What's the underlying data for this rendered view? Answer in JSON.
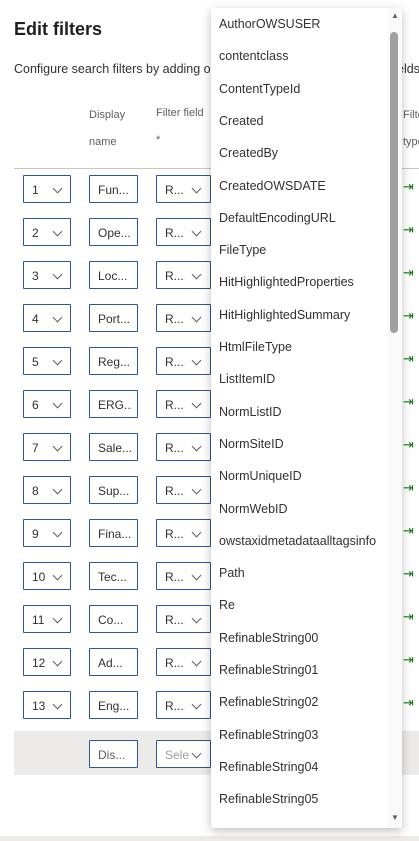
{
  "panel": {
    "title": "Edit filters",
    "description": "Configure search filters by adding o",
    "description_tail": "elds"
  },
  "headers": {
    "display_name_1": "Display",
    "display_name_2": "name",
    "filter_field_1": "Filter field",
    "filter_field_2": "*",
    "filter_type_1": "Filte",
    "filter_type_2": "type"
  },
  "rows": [
    {
      "index": "1",
      "display_name": "Fun...",
      "filter_field": "R..."
    },
    {
      "index": "2",
      "display_name": "Ope...",
      "filter_field": "R..."
    },
    {
      "index": "3",
      "display_name": "Loc...",
      "filter_field": "R..."
    },
    {
      "index": "4",
      "display_name": "Port...",
      "filter_field": "R..."
    },
    {
      "index": "5",
      "display_name": "Reg...",
      "filter_field": "R..."
    },
    {
      "index": "6",
      "display_name": "ERG...",
      "filter_field": "R..."
    },
    {
      "index": "7",
      "display_name": "Sale...",
      "filter_field": "R..."
    },
    {
      "index": "8",
      "display_name": "Sup...",
      "filter_field": "R..."
    },
    {
      "index": "9",
      "display_name": "Fina...",
      "filter_field": "R..."
    },
    {
      "index": "10",
      "display_name": "Tec...",
      "filter_field": "R..."
    },
    {
      "index": "11",
      "display_name": "Co...",
      "filter_field": "R..."
    },
    {
      "index": "12",
      "display_name": "Ad...",
      "filter_field": "R..."
    },
    {
      "index": "13",
      "display_name": "Eng...",
      "filter_field": "R..."
    }
  ],
  "new_row": {
    "display_name": "Dis...",
    "filter_field": "Sele"
  },
  "dropdown_options": [
    "AuthorOWSUSER",
    "contentclass",
    "ContentTypeId",
    "Created",
    "CreatedBy",
    "CreatedOWSDATE",
    "DefaultEncodingURL",
    "FileType",
    "HitHighlightedProperties",
    "HitHighlightedSummary",
    "HtmlFileType",
    "ListItemID",
    "NormListID",
    "NormSiteID",
    "NormUniqueID",
    "NormWebID",
    "owstaxidmetadataalltagsinfo",
    "Path",
    "Re",
    "RefinableString00",
    "RefinableString01",
    "RefinableString02",
    "RefinableString03",
    "RefinableString04",
    "RefinableString05"
  ],
  "icons": {
    "filter_type": "arrow-right-bar-icon",
    "dropdown": "chevron-down-icon"
  },
  "colors": {
    "input_border": "#2b5797",
    "arrow_green": "#107c10",
    "new_row_bg": "#edebe9"
  }
}
